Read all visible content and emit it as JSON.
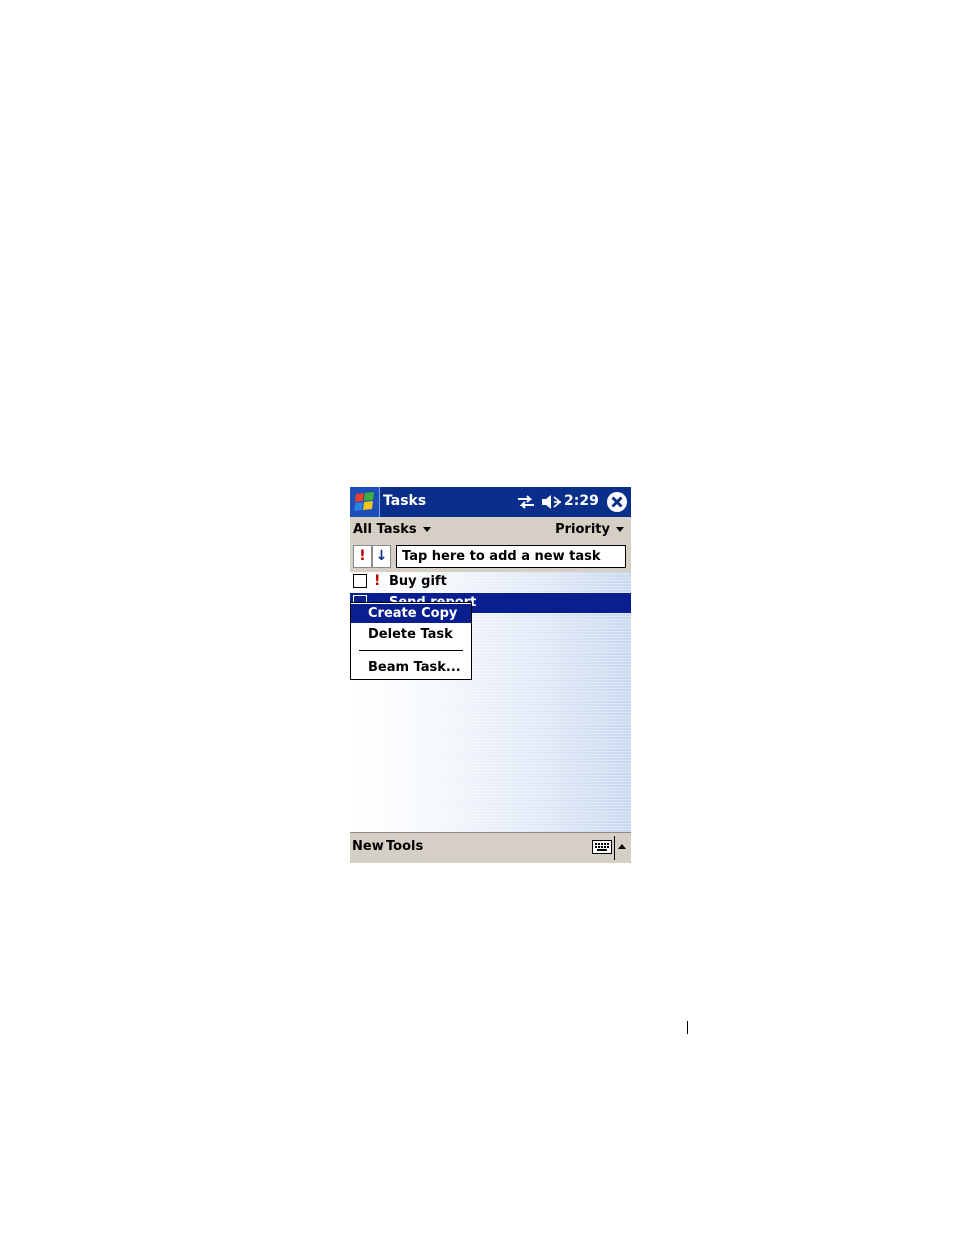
{
  "titlebar": {
    "title": "Tasks",
    "time": "2:29",
    "icons": [
      "windows-start-icon",
      "connectivity-icon",
      "speaker-muted-icon",
      "close-icon"
    ]
  },
  "filter": {
    "category": "All Tasks",
    "sort": "Priority"
  },
  "entry": {
    "priority_glyph": "!",
    "sort_glyph": "↓",
    "placeholder": "Tap here to add a new task"
  },
  "tasks": [
    {
      "label": "Buy gift",
      "high_priority": true,
      "selected": false
    },
    {
      "label": "Send report",
      "high_priority": false,
      "selected": true
    }
  ],
  "context_menu": {
    "items": [
      "Create Copy",
      "Delete Task",
      "Beam Task..."
    ],
    "highlighted": "Create Copy"
  },
  "menubar": {
    "new": "New",
    "tools": "Tools"
  },
  "colors": {
    "titlebar": "#0a2f8a",
    "selection": "#0a1f8f",
    "bar": "#d6cfc6",
    "priority": "#c00000"
  }
}
